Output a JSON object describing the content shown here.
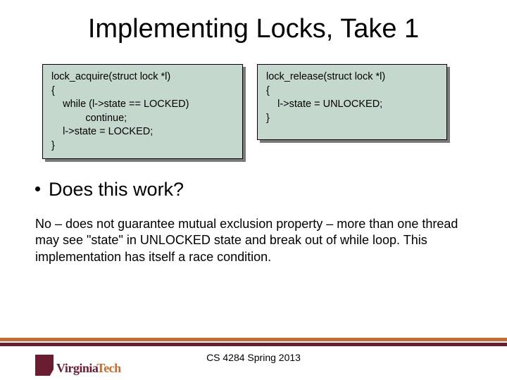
{
  "title": "Implementing Locks, Take 1",
  "code": {
    "acquire": "lock_acquire(struct lock *l)\n{\n    while (l->state == LOCKED)\n            continue;\n    l->state = LOCKED;\n}",
    "release": "lock_release(struct lock *l)\n{\n    l->state = UNLOCKED;\n}"
  },
  "bullet": "Does this work?",
  "explanation": "No – does not guarantee mutual exclusion property – more than one thread may see \"state\" in UNLOCKED state and break out of while loop. This implementation has itself a race condition.",
  "footer": {
    "course": "CS 4284 Spring 2013",
    "logo_part1": "Virginia",
    "logo_part2": "Tech"
  }
}
